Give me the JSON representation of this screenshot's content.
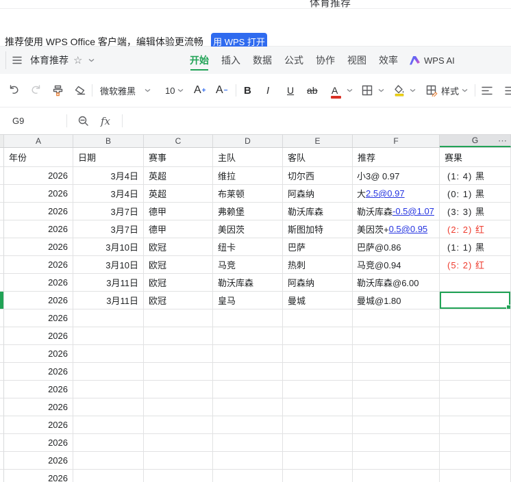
{
  "colors": {
    "accent_green": "#21a356",
    "link_blue": "#2433e0",
    "alert_red": "#ee3a2c",
    "button_blue": "#2f6bef"
  },
  "titlebar": {
    "title": "体育推荐"
  },
  "banner": {
    "message": "推荐使用 WPS Office 客户端，编辑体验更流畅",
    "open_button": "用 WPS 打开"
  },
  "menubar": {
    "doc_title": "体育推荐",
    "tabs": [
      "开始",
      "插入",
      "数据",
      "公式",
      "协作",
      "视图",
      "效率"
    ],
    "active_tab": "开始",
    "ai_label": "WPS AI"
  },
  "toolbar": {
    "font_name": "微软雅黑",
    "font_size": "10",
    "bold_label": "B",
    "italic_label": "I",
    "underline_label": "U",
    "strike_label": "ab",
    "font_color_letter": "A",
    "increase_font_letter": "A",
    "decrease_font_letter": "A",
    "style_label": "样式"
  },
  "formula_bar": {
    "name_box": "G9",
    "fx_label": "fx"
  },
  "sheet": {
    "column_letters": [
      "A",
      "B",
      "C",
      "D",
      "E",
      "F",
      "G"
    ],
    "selected_column": "G",
    "more_columns_indicator": "⋯",
    "selected_cell": "G9",
    "header_row": [
      "年份",
      "日期",
      "赛事",
      "主队",
      "客队",
      "推荐",
      "赛果"
    ],
    "rows": [
      {
        "year": "2026",
        "date": "3月4日",
        "event": "英超",
        "home": "维拉",
        "away": "切尔西",
        "tip": [
          {
            "text": "小3@ 0.97",
            "link": false
          }
        ],
        "result": "(1: 4) 黑",
        "result_red": false,
        "selected": false
      },
      {
        "year": "2026",
        "date": "3月4日",
        "event": "英超",
        "home": "布莱顿",
        "away": "阿森纳",
        "tip": [
          {
            "text": "大",
            "link": false
          },
          {
            "text": "2.5@0.97",
            "link": true
          }
        ],
        "result": "(0: 1) 黑",
        "result_red": false,
        "selected": false
      },
      {
        "year": "2026",
        "date": "3月7日",
        "event": "德甲",
        "home": "弗赖堡",
        "away": "勒沃库森",
        "tip": [
          {
            "text": "勒沃库森",
            "link": false
          },
          {
            "text": "-0.5@1.07",
            "link": true
          }
        ],
        "result": "(3: 3) 黑",
        "result_red": false,
        "selected": false
      },
      {
        "year": "2026",
        "date": "3月7日",
        "event": "德甲",
        "home": "美因茨",
        "away": "斯图加特",
        "tip": [
          {
            "text": "美因茨+",
            "link": false
          },
          {
            "text": "0.5@0.95",
            "link": true
          }
        ],
        "result": "(2: 2) 红",
        "result_red": true,
        "selected": false
      },
      {
        "year": "2026",
        "date": "3月10日",
        "event": "欧冠",
        "home": "纽卡",
        "away": "巴萨",
        "tip": [
          {
            "text": "巴萨@0.86",
            "link": false
          }
        ],
        "result": "(1: 1) 黑",
        "result_red": false,
        "selected": false
      },
      {
        "year": "2026",
        "date": "3月10日",
        "event": "欧冠",
        "home": "马竞",
        "away": "热刺",
        "tip": [
          {
            "text": "马竞@0.94",
            "link": false
          }
        ],
        "result": "(5: 2) 红",
        "result_red": true,
        "selected": false
      },
      {
        "year": "2026",
        "date": "3月11日",
        "event": "欧冠",
        "home": "勒沃库森",
        "away": "阿森纳",
        "tip": [
          {
            "text": "勒沃库森@6.00",
            "link": false
          }
        ],
        "result": "",
        "result_red": false,
        "selected": false
      },
      {
        "year": "2026",
        "date": "3月11日",
        "event": "欧冠",
        "home": "皇马",
        "away": "曼城",
        "tip": [
          {
            "text": "曼城@1.80",
            "link": false
          }
        ],
        "result": "",
        "result_red": false,
        "selected": true
      }
    ],
    "extra_year_rows": {
      "count": 10,
      "year": "2026"
    }
  }
}
